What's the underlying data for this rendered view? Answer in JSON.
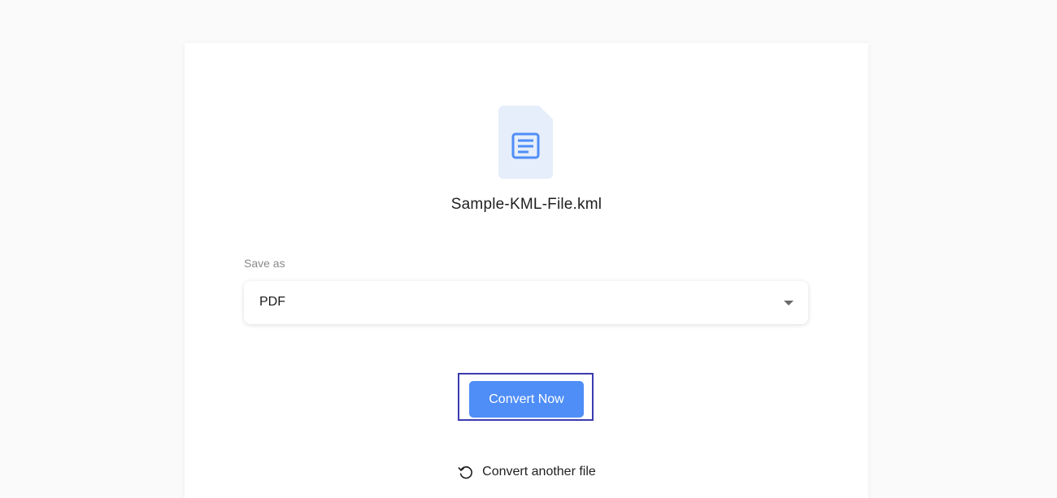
{
  "file": {
    "name": "Sample-KML-File.kml",
    "icon": "document-icon"
  },
  "save_as": {
    "label": "Save as",
    "selected": "PDF"
  },
  "convert_button": {
    "label": "Convert Now"
  },
  "convert_another": {
    "label": "Convert another file",
    "icon": "refresh-icon"
  },
  "colors": {
    "accent": "#4f8ef7",
    "highlight_border": "#3b3bb0",
    "file_icon_bg": "#e6eefb",
    "file_icon_fg": "#4f8ef7"
  }
}
